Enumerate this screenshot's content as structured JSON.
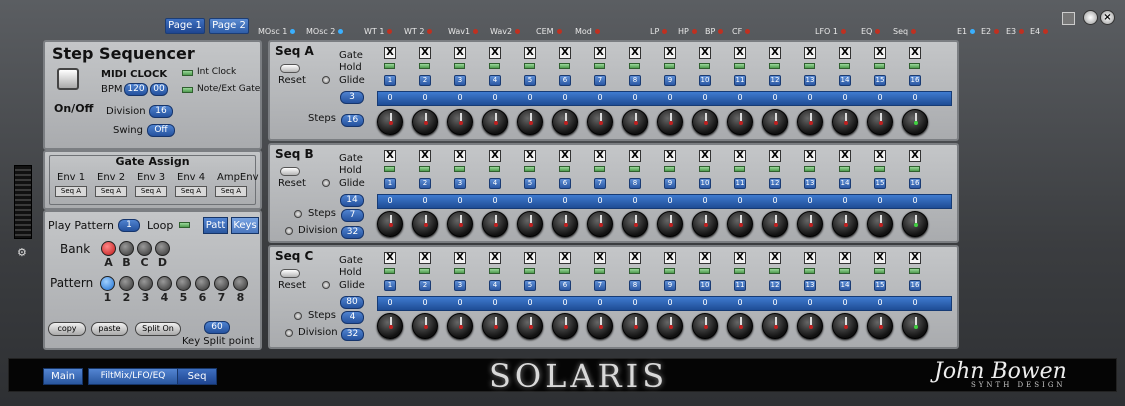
{
  "top_tabs": [
    "Page 1",
    "Page 2"
  ],
  "top_labels": [
    "MOsc 1",
    "MOsc 2",
    "WT 1",
    "WT 2",
    "Wav1",
    "Wav2",
    "CEM",
    "Mod",
    "LP",
    "HP",
    "BP",
    "CF",
    "LFO 1",
    "EQ",
    "Seq",
    "E1",
    "E2",
    "E3",
    "E4"
  ],
  "step_sequencer": {
    "title": "Step Sequencer",
    "onoff_label": "On/Off",
    "midi_clock": "MIDI CLOCK",
    "bpm_label": "BPM",
    "bpm_int": "120",
    "bpm_dec": "00",
    "int_clock": "Int Clock",
    "note_ext_gate": "Note/Ext Gate",
    "division_label": "Division",
    "division_value": "16",
    "swing_label": "Swing",
    "swing_value": "Off"
  },
  "gate_assign": {
    "title": "Gate Assign",
    "columns": [
      {
        "label": "Env 1",
        "value": "Seq A"
      },
      {
        "label": "Env 2",
        "value": "Seq A"
      },
      {
        "label": "Env 3",
        "value": "Seq A"
      },
      {
        "label": "Env 4",
        "value": "Seq A"
      },
      {
        "label": "AmpEnv",
        "value": "Seq A"
      }
    ]
  },
  "pattern": {
    "play_pattern_label": "Play Pattern",
    "play_pattern_value": "1",
    "loop_label": "Loop",
    "patt_tab": "Patt",
    "keys_tab": "Keys",
    "bank_label": "Bank",
    "bank_letters": [
      "A",
      "B",
      "C",
      "D"
    ],
    "pattern_label": "Pattern",
    "pattern_numbers": [
      "1",
      "2",
      "3",
      "4",
      "5",
      "6",
      "7",
      "8"
    ],
    "copy_label": "copy",
    "paste_label": "paste",
    "split_label": "Split On",
    "key_split_value": "60",
    "key_split_label": "Key Split point"
  },
  "row_labels": {
    "gate": "Gate",
    "hold": "Hold",
    "glide": "Glide",
    "reset": "Reset",
    "steps": "Steps",
    "division": "Division"
  },
  "step_numbers": [
    "1",
    "2",
    "3",
    "4",
    "5",
    "6",
    "7",
    "8",
    "9",
    "10",
    "11",
    "12",
    "13",
    "14",
    "15",
    "16"
  ],
  "gate_mark": "X",
  "sequences": [
    {
      "name": "Seq A",
      "glide": "3",
      "steps": "16",
      "values": [
        "0",
        "0",
        "0",
        "0",
        "0",
        "0",
        "0",
        "0",
        "0",
        "0",
        "0",
        "0",
        "0",
        "0",
        "0",
        "0"
      ]
    },
    {
      "name": "Seq B",
      "glide": "14",
      "steps": "7",
      "division": "32",
      "values": [
        "0",
        "0",
        "0",
        "0",
        "0",
        "0",
        "0",
        "0",
        "0",
        "0",
        "0",
        "0",
        "0",
        "0",
        "0",
        "0"
      ]
    },
    {
      "name": "Seq C",
      "glide": "80",
      "steps": "4",
      "division": "32",
      "values": [
        "0",
        "0",
        "0",
        "0",
        "0",
        "0",
        "0",
        "0",
        "0",
        "0",
        "0",
        "0",
        "0",
        "0",
        "0",
        "0"
      ]
    }
  ],
  "bottom_tabs": [
    "Main",
    "FiltMix/LFO/EQ",
    "Seq"
  ],
  "logo": "SOLARIS",
  "brand": "John Bowen",
  "brand_sub": "SYNTH DESIGN",
  "colors": {
    "accent": "#2e5da8",
    "led_red": "#c03020",
    "led_green": "#4f9b4f"
  }
}
